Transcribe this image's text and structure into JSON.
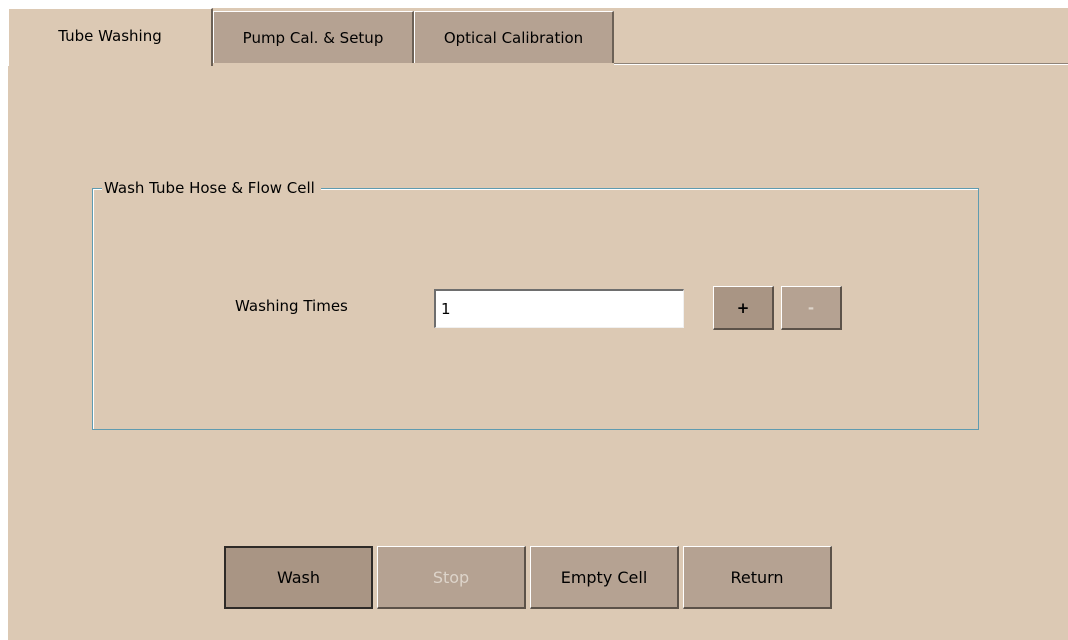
{
  "tabs": [
    {
      "label": "Tube Washing",
      "active": true
    },
    {
      "label": "Pump Cal. & Setup",
      "active": false
    },
    {
      "label": "Optical Calibration",
      "active": false
    }
  ],
  "group": {
    "title": "Wash Tube Hose & Flow Cell",
    "washing_times_label": "Washing Times",
    "washing_times_value": "1",
    "plus_label": "+",
    "minus_label": "-"
  },
  "buttons": {
    "wash": "Wash",
    "stop": "Stop",
    "empty_cell": "Empty Cell",
    "return": "Return"
  },
  "colors": {
    "background": "#dcc9b4",
    "button": "#b5a292",
    "group_border": "#5f9bb0",
    "disabled_text": "#ddd4ca"
  }
}
